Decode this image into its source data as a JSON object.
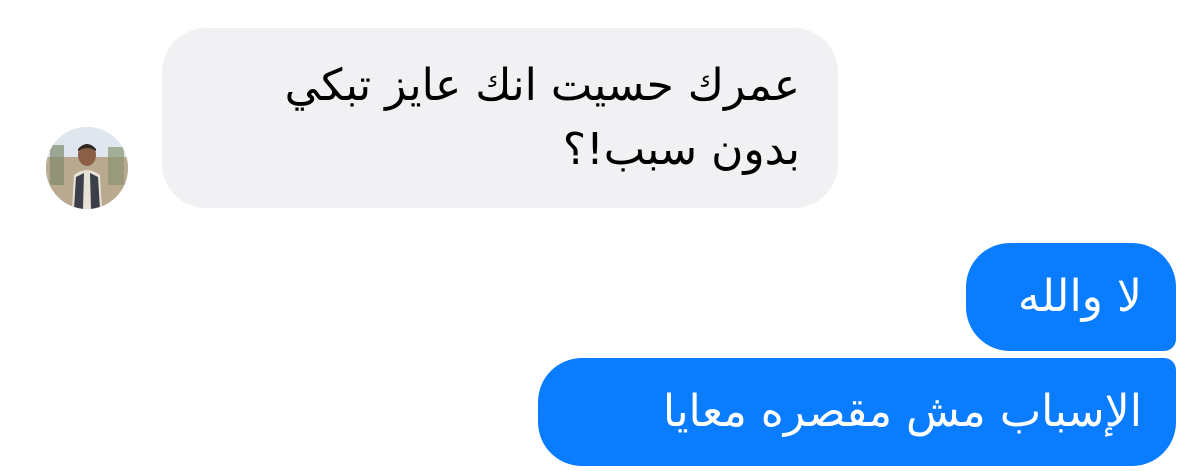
{
  "conversation": {
    "messages": [
      {
        "direction": "incoming",
        "lines": [
          "عمرك حسيت انك عايز تبكي",
          "بدون سبب!؟"
        ]
      },
      {
        "direction": "outgoing",
        "text": "لا والله"
      },
      {
        "direction": "outgoing",
        "text": "الإسباب مش مقصره معايا"
      }
    ]
  },
  "colors": {
    "outgoing_bubble": "#0a7cff",
    "incoming_bubble": "#f1f1f4",
    "outgoing_text": "#ffffff",
    "incoming_text": "#000000"
  },
  "icons": {
    "avatar": "sender-avatar-photo"
  }
}
